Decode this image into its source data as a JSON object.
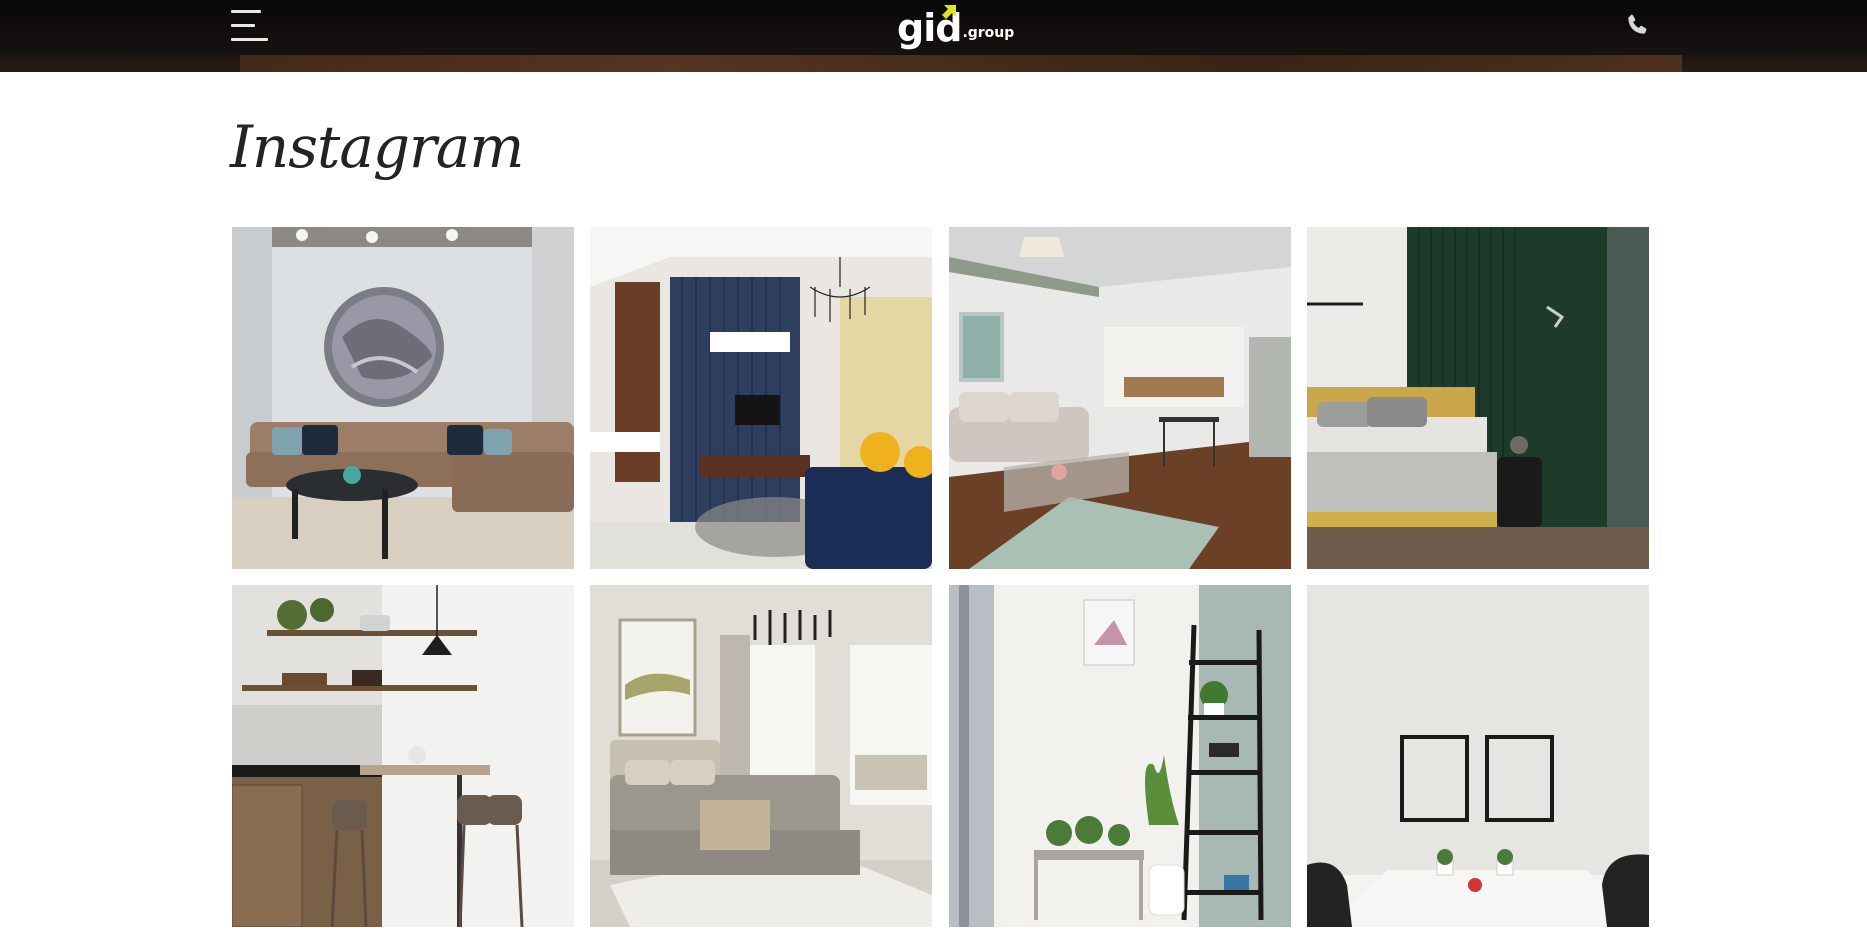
{
  "header": {
    "logo_main": "gid",
    "logo_sub": ".group",
    "logo_accent_color": "#e6e31a",
    "menu_icon": "hamburger-menu-icon",
    "phone_icon": "phone-icon"
  },
  "section": {
    "title": "Instagram"
  },
  "gallery": {
    "items": [
      {
        "name": "living-room-round-art"
      },
      {
        "name": "living-room-blue-tv-wall"
      },
      {
        "name": "open-plan-living-kitchen"
      },
      {
        "name": "bedroom-green-wall"
      },
      {
        "name": "kitchen-shelves-bar-stools"
      },
      {
        "name": "bedroom-chandelier"
      },
      {
        "name": "corner-shelf-plants"
      },
      {
        "name": "white-wall-two-frames"
      }
    ]
  }
}
